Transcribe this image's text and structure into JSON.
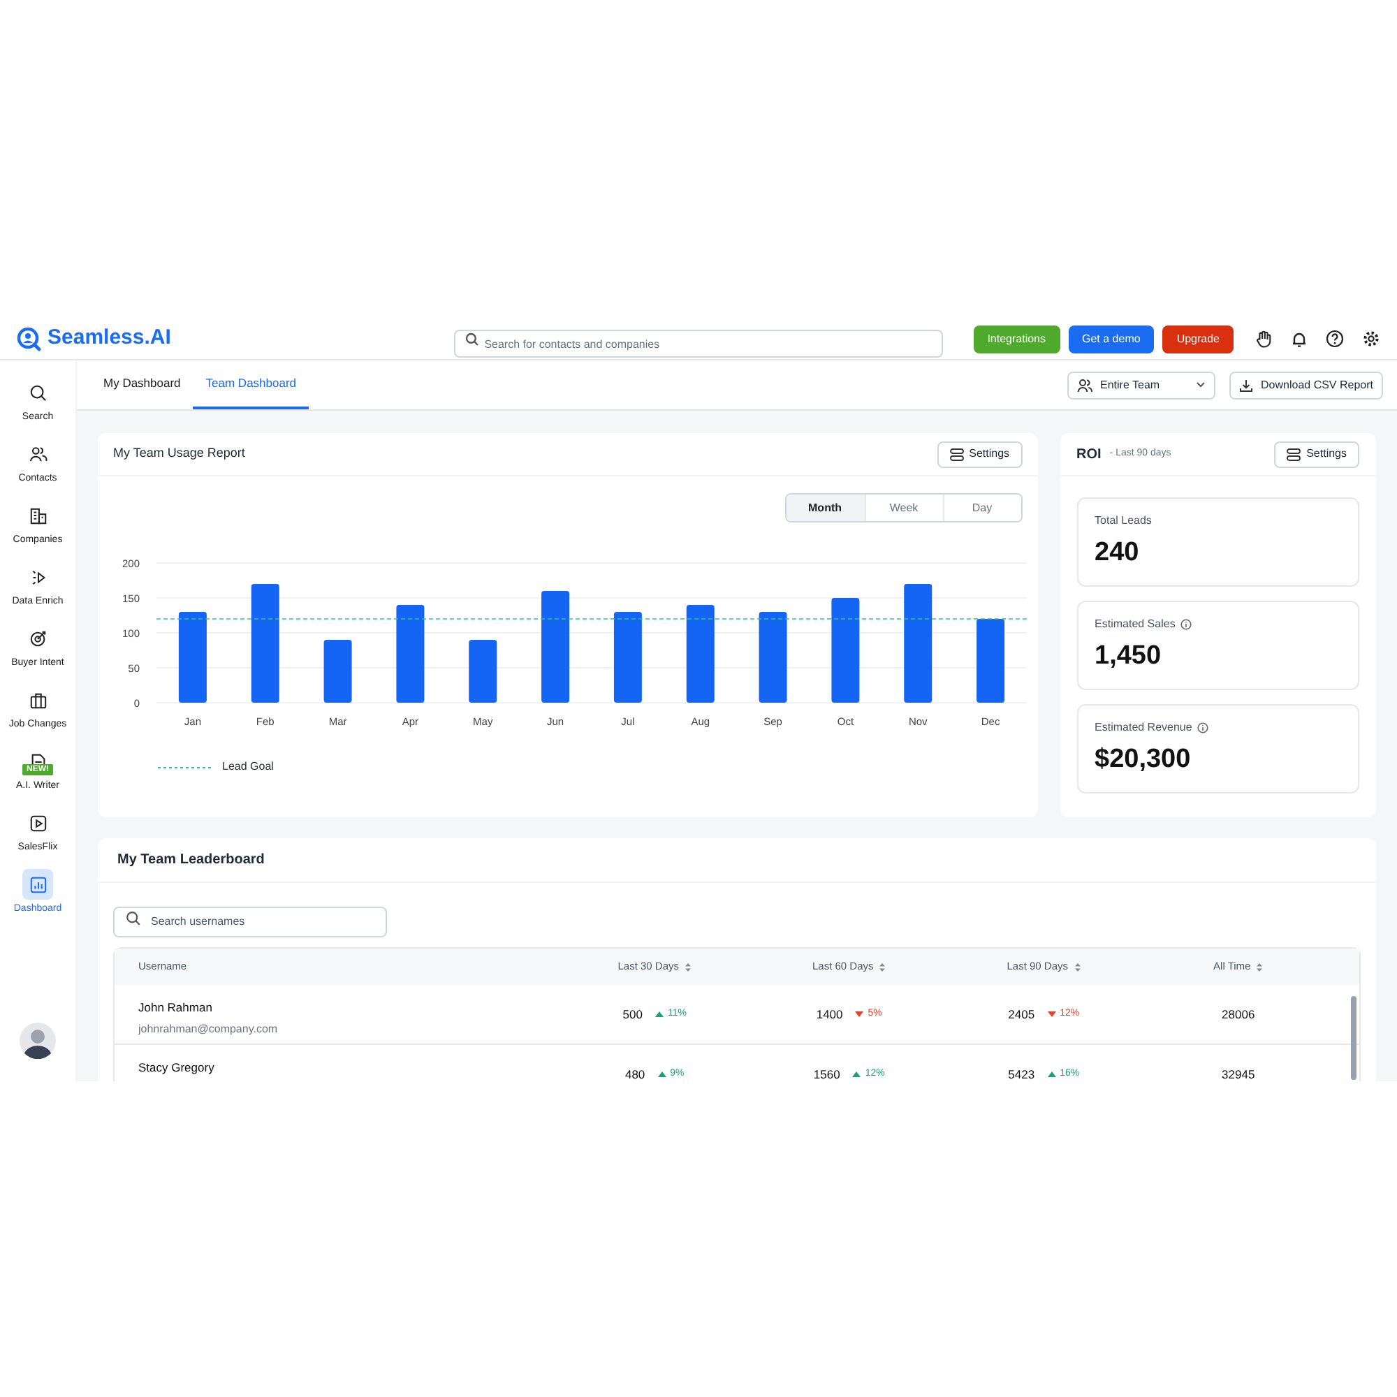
{
  "header": {
    "logo": "Seamless.AI",
    "search_placeholder": "Search for contacts and companies",
    "buttons": [
      {
        "label": "Integrations",
        "kind": "integrations"
      },
      {
        "label": "Get a demo",
        "kind": "demo"
      },
      {
        "label": "Upgrade",
        "kind": "upgrade"
      }
    ]
  },
  "sidebar": {
    "items": [
      {
        "label": "Search",
        "selected": false
      },
      {
        "label": "Contacts",
        "selected": false
      },
      {
        "label": "Companies",
        "selected": false
      },
      {
        "label": "Data Enrich",
        "selected": false
      },
      {
        "label": "Buyer Intent",
        "selected": false
      },
      {
        "label": "Job Changes",
        "selected": false
      },
      {
        "label": "A.I. Writer",
        "selected": false,
        "badge": "NEW!"
      },
      {
        "label": "SalesFlix",
        "selected": false
      },
      {
        "label": "Dashboard",
        "selected": true
      }
    ]
  },
  "tabs": [
    {
      "label": "My Dashboard",
      "selected": false
    },
    {
      "label": "Team Dashboard",
      "selected": true
    }
  ],
  "team_select": "Entire Team",
  "download_button": "Download CSV Report",
  "usage_report": {
    "title": "My Team Usage Report",
    "settings": "Settings",
    "periods": [
      {
        "label": "Month",
        "selected": true
      },
      {
        "label": "Week",
        "selected": false
      },
      {
        "label": "Day",
        "selected": false
      }
    ],
    "chart_data": {
      "type": "bar",
      "categories": [
        "Jan",
        "Feb",
        "Mar",
        "Apr",
        "May",
        "Jun",
        "Jul",
        "Aug",
        "Sep",
        "Oct",
        "Nov",
        "Dec"
      ],
      "series": [
        {
          "color": "#1565f5",
          "values": [
            130,
            170,
            90,
            140,
            90,
            160,
            130,
            140,
            130,
            150,
            170,
            120
          ]
        }
      ],
      "ylim": [
        0,
        200
      ],
      "yticks": [
        0,
        50,
        100,
        150,
        200
      ],
      "grid": true,
      "ref_lines": [
        {
          "axis": "y",
          "value": 120,
          "label": "Lead Goal",
          "color": "#34c38f"
        }
      ]
    }
  },
  "roi": {
    "title": "ROI",
    "subtitle": "- Last 90 days",
    "settings": "Settings",
    "stats": [
      {
        "label": "Total Leads",
        "value": "240",
        "info": false
      },
      {
        "label": "Estimated Sales",
        "value": "1,450",
        "info": true
      },
      {
        "label": "Estimated Revenue",
        "value": "$20,300",
        "info": true
      }
    ]
  },
  "leaderboard": {
    "title": "My Team Leaderboard",
    "search_placeholder": "Search usernames",
    "columns": [
      "Username",
      "Last 30 Days",
      "Last 60 Days",
      "Last 90 Days",
      "All Time"
    ],
    "rows": [
      {
        "name": "John Rahman",
        "email": "johnrahman@company.com",
        "periods": [
          {
            "value": "500",
            "change": "11%",
            "kind": "up"
          },
          {
            "value": "1400",
            "change": "5%",
            "kind": "down"
          },
          {
            "value": "2405",
            "change": "12%",
            "kind": "down"
          }
        ],
        "all_time": "28006"
      },
      {
        "name": "Stacy Gregory",
        "periods": [
          {
            "value": "480",
            "change": "9%",
            "kind": "up"
          },
          {
            "value": "1560",
            "change": "12%",
            "kind": "up"
          },
          {
            "value": "5423",
            "change": "16%",
            "kind": "up"
          }
        ],
        "all_time": "32945"
      }
    ]
  }
}
